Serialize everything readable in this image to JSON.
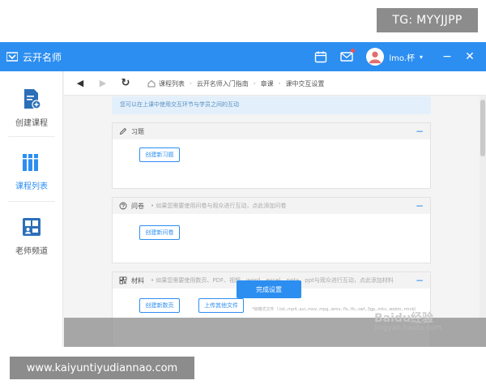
{
  "overlays": {
    "telegram": "TG: MYYJJPP",
    "site_url": "www.kaiyuntiyudiannao.com"
  },
  "titlebar": {
    "brand": "云开名师",
    "user_name": "lmo.杯",
    "caret": "▾",
    "min": "−",
    "close": "✕"
  },
  "sidebar": {
    "items": [
      {
        "label": "创建课程",
        "icon": "create-course-icon"
      },
      {
        "label": "课程列表",
        "icon": "course-list-icon",
        "active": true
      },
      {
        "label": "老师频道",
        "icon": "teacher-channel-icon"
      }
    ]
  },
  "nav": {
    "back": "◀",
    "forward": "▶",
    "refresh": "↻",
    "breadcrumb": [
      "课程列表",
      "云开名师入门指南",
      "章课",
      "课中交互设置"
    ]
  },
  "tip": "您可以在上课中使用交互环节与学员之间的互动",
  "sections": {
    "exercise": {
      "title": "习题",
      "button": "创建新习题"
    },
    "questionnaire": {
      "title": "问卷",
      "hint": "• 如果您需要使用问卷与观众进行互动，点此添加问卷",
      "button": "创建新问卷"
    },
    "material": {
      "title": "材料",
      "hint": "• 如果您需要使用数页、PDF、视频、word、excel、pptx、ppt与观众进行互动，点此添加材料",
      "button_new": "创建新数页",
      "button_upload": "上传其他文件",
      "file_hint": "*如格式文件（.txt,.mp4,.avi,.mov,.mpg,.wmv,.flv,.flc,.swf,.3gp,.mkv,.webm,.rmvb）"
    }
  },
  "footer": {
    "primary": "完成设置"
  },
  "watermark": {
    "logo": "Baidu经验",
    "url": "jingyan.baidu.com"
  },
  "colors": {
    "accent": "#2c8ef0",
    "tip_bg": "#e3f0fb"
  }
}
